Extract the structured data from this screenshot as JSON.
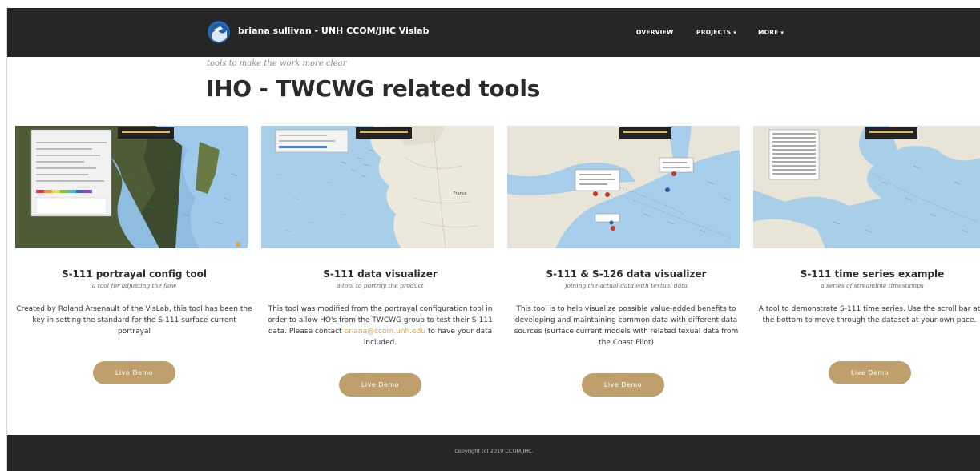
{
  "navbar": {
    "brand_name": "briana sullivan - UNH CCOM/JHC Vislab",
    "items": [
      {
        "label": "OVERVIEW",
        "has_caret": false
      },
      {
        "label": "PROJECTS",
        "has_caret": true
      },
      {
        "label": "MORE",
        "has_caret": true
      }
    ],
    "caret_icon": "caret-down-icon"
  },
  "header": {
    "tagline": "tools to make the work more clear",
    "title": "IHO - TWCWG related tools"
  },
  "cards": [
    {
      "title": "S-111 portrayal config tool",
      "subtitle": "a tool for adjusting the flow",
      "description": "Created by Roland Arsenault of the VisLab, this tool has been the key in setting the standard for the S-111 surface current portrayal",
      "button": "Live Demo"
    },
    {
      "title": "S-111 data visualizer",
      "subtitle": "a tool to portray the product",
      "description_before": "This tool was modified from the portrayal configuration tool in order to allow HO's from the TWCWG group to test their S-111 data. Please contact",
      "email": "briana@ccom.unh.edu",
      "description_after": "to have your data included.",
      "button": "Live Demo"
    },
    {
      "title": "S-111 & S-126 data visualizer",
      "subtitle": "joining the actual data with textual data",
      "description": "This tool is to help visualize possible value-added benefits to developing and maintaining common data with different data sources (surface current models with related texual data from the Coast Pilot)",
      "button": "Live Demo"
    },
    {
      "title": "S-111 time series example",
      "subtitle": "a series of streamline timestamps",
      "description": "A tool to demonstrate S-111 time series. Use the scroll bar at the bottom to move through the dataset at your own pace.",
      "button": "Live Demo"
    }
  ],
  "footer": {
    "copyright": "Copyright (c) 2019 CCOM/JHC."
  },
  "colors": {
    "navbar": "#262626",
    "button": "#bfa06d",
    "link": "#e8a23b",
    "water": "#a9cbe6",
    "land": "#e8e4d8"
  }
}
